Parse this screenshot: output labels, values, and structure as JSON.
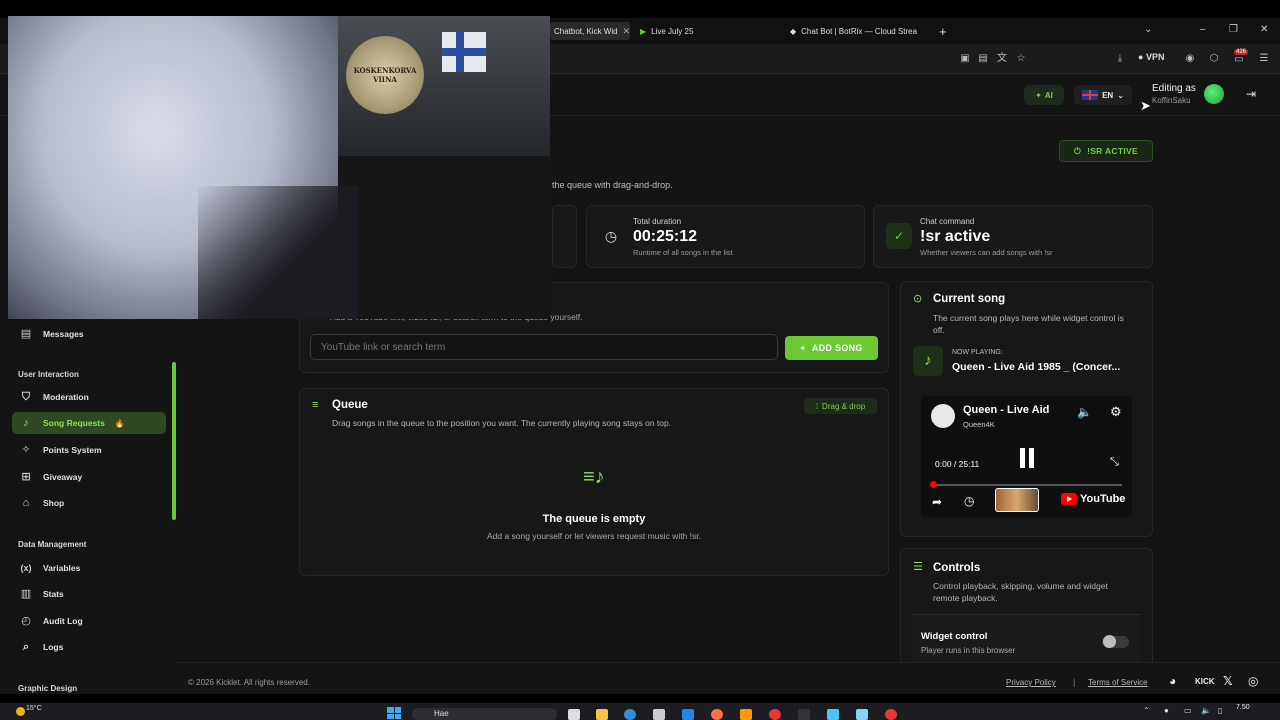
{
  "browser": {
    "tabs": [
      {
        "label": "Chatbot, Kick Wid"
      },
      {
        "label": "Live July 25"
      },
      {
        "label": "Chat Bot | BotRix — Cloud Strea"
      }
    ],
    "vpn_label": "VPN",
    "extension_badge": "426"
  },
  "header": {
    "ai_label": "AI",
    "lang_label": "EN",
    "editing_as": "Editing as",
    "username": "KoffinSaku"
  },
  "sidebar": {
    "items_top": [
      {
        "label": "Messages",
        "icon": "chat-icon"
      }
    ],
    "sections": [
      {
        "title": "User Interaction"
      },
      {
        "title": "Data Management"
      },
      {
        "title": "Graphic Design"
      }
    ],
    "user_interaction": [
      {
        "label": "Moderation",
        "icon": "shield-icon"
      },
      {
        "label": "Song Requests",
        "icon": "music-note-icon",
        "active": true
      },
      {
        "label": "Points System",
        "icon": "sparkle-icon"
      },
      {
        "label": "Giveaway",
        "icon": "gift-icon"
      },
      {
        "label": "Shop",
        "icon": "shop-icon"
      }
    ],
    "data_management": [
      {
        "label": "Variables",
        "icon": "variable-icon"
      },
      {
        "label": "Stats",
        "icon": "stats-icon"
      },
      {
        "label": "Audit Log",
        "icon": "audit-icon"
      },
      {
        "label": "Logs",
        "icon": "logs-icon"
      }
    ]
  },
  "main": {
    "isr_badge": "!SR ACTIVE",
    "subtitle": "the queue with drag-and-drop.",
    "stats": [
      {
        "label": "Total duration",
        "value": "00:25:12",
        "desc": "Runtime of all songs in the list"
      },
      {
        "label": "Chat command",
        "value": "!sr active",
        "desc": "Whether viewers can add songs with !sr"
      }
    ],
    "add_song": {
      "desc": "Add a YouTube link, video ID, or search term to the queue yourself.",
      "placeholder": "YouTube link or search term",
      "button": "ADD SONG"
    },
    "queue": {
      "title": "Queue",
      "badge": "Drag & drop",
      "desc": "Drag songs in the queue to the position you want. The currently playing song stays on top.",
      "empty_title": "The queue is empty",
      "empty_desc": "Add a song yourself or let viewers request music with !sr."
    },
    "current_song": {
      "title": "Current song",
      "desc": "The current song plays here while widget control is off.",
      "now_playing_label": "NOW PLAYING:",
      "now_playing": "Queen - Live Aid 1985 _ (Concer...",
      "player_title": "Queen - Live Aid",
      "player_channel": "Queen4K",
      "player_time": "0:00 / 25:11",
      "player_logo": "YouTube"
    },
    "controls": {
      "title": "Controls",
      "desc": "Control playback, skipping, volume and widget remote playback.",
      "widget_title": "Widget control",
      "widget_desc": "Player runs in this browser",
      "widget_on": false
    }
  },
  "footer": {
    "copyright": "© 2026 Kicklet. All rights reserved.",
    "privacy": "Privacy Policy",
    "separator": "|",
    "terms": "Terms of Service",
    "kick": "KICK"
  },
  "webcam": {
    "poster_text": "KOSKENKORVA VIINA"
  },
  "taskbar": {
    "temperature": "15°C",
    "search": "Hae",
    "time": "7.50"
  }
}
